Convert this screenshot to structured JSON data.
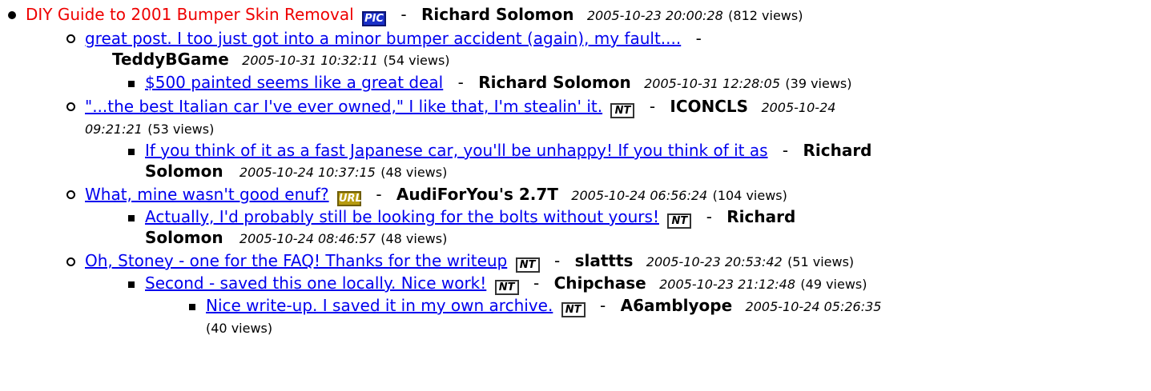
{
  "separator": "-",
  "posts": [
    {
      "title": "DIY Guide to 2001 Bumper Skin Removal",
      "badge": "PIC",
      "author": "Richard Solomon",
      "timestamp": "2005-10-23 20:00:28",
      "views": "(812 views)"
    },
    {
      "title": "great post. I too just got into a minor bumper accident (again), my fault....",
      "author": "TeddyBGame",
      "timestamp": "2005-10-31 10:32:11",
      "views": "(54 views)"
    },
    {
      "title": "$500 painted seems like a great deal",
      "author": "Richard Solomon",
      "timestamp": "2005-10-31 12:28:05",
      "views": "(39 views)"
    },
    {
      "title": "\"...the best Italian car I've ever owned,\" I like that, I'm stealin' it.",
      "badge": "NT",
      "author": "ICONCLS",
      "timestamp_date": "2005-10-24",
      "timestamp_time": "09:21:21",
      "views": "(53 views)"
    },
    {
      "title": "If you think of it as a fast Japanese car, you'll be unhappy! If you think of it as",
      "author_first": "Richard",
      "author_last": "Solomon",
      "timestamp": "2005-10-24 10:37:15",
      "views": "(48 views)"
    },
    {
      "title": "What, mine wasn't good enuf?",
      "badge": "URL",
      "author": "AudiForYou's 2.7T",
      "timestamp": "2005-10-24 06:56:24",
      "views": "(104 views)"
    },
    {
      "title": "Actually, I'd probably still be looking for the bolts without yours!",
      "badge": "NT",
      "author_first": "Richard",
      "author_last": "Solomon",
      "timestamp": "2005-10-24 08:46:57",
      "views": "(48 views)"
    },
    {
      "title": "Oh, Stoney - one for the FAQ! Thanks for the writeup",
      "badge": "NT",
      "author": "slattts",
      "timestamp": "2005-10-23 20:53:42",
      "views": "(51 views)"
    },
    {
      "title": "Second - saved this one locally. Nice work!",
      "badge": "NT",
      "author": "Chipchase",
      "timestamp": "2005-10-23 21:12:48",
      "views": "(49 views)"
    },
    {
      "title": "Nice write-up. I saved it in my own archive.",
      "badge": "NT",
      "author": "A6amblyope",
      "timestamp": "2005-10-24 05:26:35",
      "views": "(40 views)"
    }
  ]
}
